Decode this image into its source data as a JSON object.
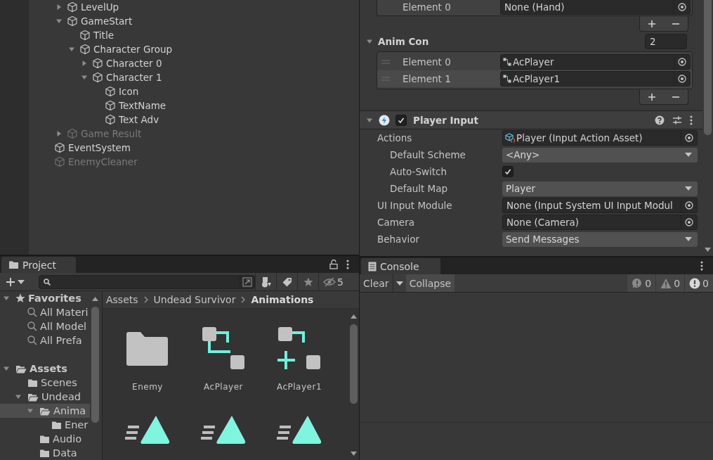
{
  "hierarchy": {
    "items": [
      {
        "children": [
          {
            "label": "LevelUp",
            "active": true,
            "expanded": false
          },
          {
            "label": "GameStart",
            "active": true,
            "expanded": true,
            "children": [
              {
                "label": "Title",
                "active": true
              },
              {
                "label": "Character Group",
                "active": true,
                "expanded": true,
                "children": [
                  {
                    "label": "Character 0",
                    "active": true,
                    "expanded": false
                  },
                  {
                    "label": "Character 1",
                    "active": true,
                    "expanded": true,
                    "children": [
                      {
                        "label": "Icon",
                        "active": true
                      },
                      {
                        "label": "TextName",
                        "active": true
                      },
                      {
                        "label": "Text Adv",
                        "active": true
                      }
                    ]
                  }
                ]
              }
            ]
          },
          {
            "label": "Game Result",
            "active": false,
            "expanded": false
          }
        ]
      },
      {
        "label": "EventSystem",
        "active": true
      },
      {
        "label": "EnemyCleaner",
        "active": false
      }
    ]
  },
  "inspector": {
    "partial_list": {
      "label": "Element 0",
      "value": "None (Hand)"
    },
    "anim_con": {
      "label": "Anim Con",
      "expanded": true,
      "size": "2",
      "elements": [
        {
          "label": "Element 0",
          "value": "AcPlayer",
          "selected": false
        },
        {
          "label": "Element 1",
          "value": "AcPlayer1",
          "selected": true
        }
      ]
    },
    "component": {
      "title": "Player Input",
      "expanded": true,
      "enabled": true,
      "properties": [
        {
          "kind": "object",
          "label": "Actions",
          "value": "Player (Input Action Asset)",
          "asset_icon": true,
          "children": [
            {
              "kind": "dropdown",
              "label": "Default Scheme",
              "value": "<Any>"
            },
            {
              "kind": "toggle",
              "label": "Auto-Switch",
              "checked": true
            },
            {
              "kind": "dropdown",
              "label": "Default Map",
              "value": "Player"
            }
          ]
        },
        {
          "kind": "object",
          "label": "UI Input Module",
          "value": "None (Input System UI Input Modul",
          "asset_icon": false
        },
        {
          "kind": "object",
          "label": "Camera",
          "value": "None (Camera)",
          "asset_icon": false
        },
        {
          "kind": "dropdown",
          "label": "Behavior",
          "value": "Send Messages"
        }
      ]
    }
  },
  "project": {
    "tab": "Project",
    "hidden_count": "5",
    "tree": [
      {
        "label": "Favorites",
        "kind": "favorites",
        "expanded": true,
        "selected": false,
        "children": [
          {
            "label": "All Materi",
            "kind": "search",
            "selected": false
          },
          {
            "label": "All Model",
            "kind": "search",
            "selected": false
          },
          {
            "label": "All Prefa",
            "kind": "search",
            "selected": false
          }
        ]
      },
      {
        "label": "Assets",
        "kind": "folder",
        "expanded": true,
        "selected": false,
        "children": [
          {
            "label": "Scenes",
            "kind": "folder",
            "selected": false
          },
          {
            "label": "Undead",
            "kind": "folder",
            "expanded": true,
            "selected": false,
            "children": [
              {
                "label": "Anima",
                "kind": "folder",
                "expanded": true,
                "selected": true,
                "children": [
                  {
                    "label": "Ener",
                    "kind": "folder",
                    "selected": false
                  }
                ]
              },
              {
                "label": "Audio",
                "kind": "folder",
                "selected": false
              },
              {
                "label": "Data",
                "kind": "folder",
                "selected": false
              }
            ]
          }
        ]
      }
    ],
    "breadcrumb": [
      "Assets",
      "Undead Survivor",
      "Animations"
    ],
    "assets": [
      {
        "name": "Enemy",
        "kind": "folder"
      },
      {
        "name": "AcPlayer",
        "kind": "controller"
      },
      {
        "name": "AcPlayer1",
        "kind": "override"
      },
      {
        "kind": "clip"
      },
      {
        "kind": "clip"
      },
      {
        "kind": "clip"
      }
    ]
  },
  "console": {
    "tab": "Console",
    "clear": "Clear",
    "collapse": {
      "label": "Collapse",
      "on": true
    },
    "counts": [
      {
        "kind": "info",
        "count": "0"
      },
      {
        "kind": "warning",
        "count": "0"
      },
      {
        "kind": "error",
        "count": "0"
      }
    ]
  }
}
